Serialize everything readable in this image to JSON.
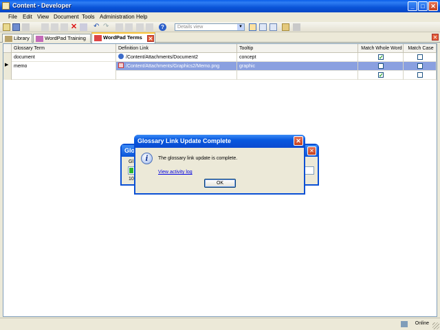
{
  "window": {
    "title": "Content - Developer"
  },
  "menu": {
    "items": [
      "File",
      "Edit",
      "View",
      "Document",
      "Tools",
      "Administration",
      "Help"
    ]
  },
  "toolbar": {
    "view_select": "Details view"
  },
  "tabs": [
    {
      "label": "Library",
      "active": false
    },
    {
      "label": "WordPad Training",
      "active": false
    },
    {
      "label": "WordPad Terms",
      "active": true
    }
  ],
  "grid": {
    "columns": [
      "Glossary Term",
      "Definition Link",
      "Tooltip",
      "Match Whole Word",
      "Match Case"
    ],
    "rows": [
      {
        "term": "document",
        "link": "/Content/Attachments/Document2",
        "tooltip": "concept",
        "whole_word": true,
        "match_case": false,
        "selected": false
      },
      {
        "term": "memo",
        "link": "/Content/Attachments/Graphics2/Memo.png",
        "tooltip": "graphic",
        "whole_word": false,
        "match_case": false,
        "selected": true
      },
      {
        "term": "",
        "link": "",
        "tooltip": "",
        "whole_word": true,
        "match_case": false,
        "selected": false
      }
    ]
  },
  "bg_dialog": {
    "title_fragment": "Glos",
    "label_fragment": "Gl",
    "percent_fragment": "10"
  },
  "dialog": {
    "title": "Glossary Link Update Complete",
    "message": "The glossary link update is complete.",
    "link": "View activity log",
    "ok_label": "OK"
  },
  "status": {
    "online": "Online"
  },
  "colors": {
    "title_blue": "#0a54d8",
    "selection": "#8aa0e0",
    "check_green": "#21a121"
  }
}
